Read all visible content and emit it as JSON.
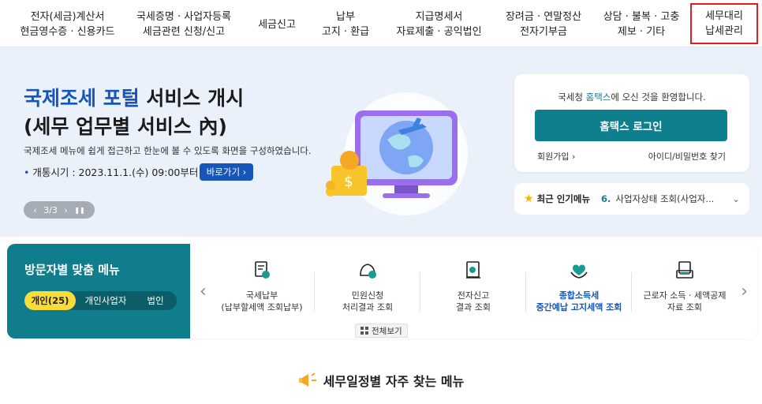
{
  "nav": {
    "items": [
      {
        "line1": "전자(세금)계산서",
        "line2": "현금영수증 · 신용카드"
      },
      {
        "line1": "국세증명 · 사업자등록",
        "line2": "세금관련 신청/신고"
      },
      {
        "line1": "세금신고",
        "line2": ""
      },
      {
        "line1": "납부",
        "line2": "고지 · 환급"
      },
      {
        "line1": "지급명세서",
        "line2": "자료제출 · 공익법인"
      },
      {
        "line1": "장려금 · 연말정산",
        "line2": "전자기부금"
      },
      {
        "line1": "상담 · 불복 · 고충",
        "line2": "제보 · 기타"
      },
      {
        "line1": "세무대리",
        "line2": "납세관리"
      }
    ]
  },
  "hero": {
    "title_accent": "국제조세 포털",
    "title_rest": " 서비스 개시",
    "title_line2": "(세무 업무별 서비스 內)",
    "desc": "국제조세 메뉴에 쉽게 접근하고 한눈에 볼 수 있도록 화면을 구성하였습니다.",
    "date_label": "개통시기 : 2023.11.1.(수) 09:00부터",
    "shortcut_label": "바로가기 ›",
    "pager": {
      "prev": "‹",
      "page": "3/3",
      "next": "›",
      "pause": "❚❚"
    }
  },
  "login": {
    "welcome_prefix": "국세청 ",
    "welcome_hl": "홈택스",
    "welcome_suffix": "에 오신 것을 환영합니다.",
    "button": "홈택스 로그인",
    "join": "회원가입 ›",
    "find": "아이디/비밀번호 찾기"
  },
  "popular": {
    "label": "최근 인기메뉴",
    "num": "6.",
    "item": "사업자상태 조회(사업자...",
    "chevron": "⌄"
  },
  "visitor": {
    "title": "방문자별 맞춤 메뉴",
    "tabs": [
      "개인(25)",
      "개인사업자",
      "법인"
    ]
  },
  "quick_menu": [
    {
      "icon": "tax-payment-icon",
      "line1": "국세납부",
      "line2": "(납부할세액 조회납부)",
      "emphasis": false
    },
    {
      "icon": "civil-petition-icon",
      "line1": "민원신청",
      "line2": "처리결과 조회",
      "emphasis": false
    },
    {
      "icon": "e-filing-icon",
      "line1": "전자신고",
      "line2": "결과 조회",
      "emphasis": false
    },
    {
      "icon": "income-tax-icon",
      "line1": "종합소득세",
      "line2": "중간예납 고지세액 조회",
      "emphasis": true
    },
    {
      "icon": "worker-income-icon",
      "line1": "근로자 소득 · 세액공제",
      "line2": "자료 조회",
      "emphasis": false
    }
  ],
  "all_view": "전체보기",
  "schedule_title": "세무일정별 자주 찾는 메뉴",
  "colors": {
    "teal": "#0f7d8b",
    "blue": "#1556b8",
    "hero_bg": "#eaf1fb",
    "tab_active": "#f8dc3c",
    "highlight_border": "#e01e1e"
  }
}
